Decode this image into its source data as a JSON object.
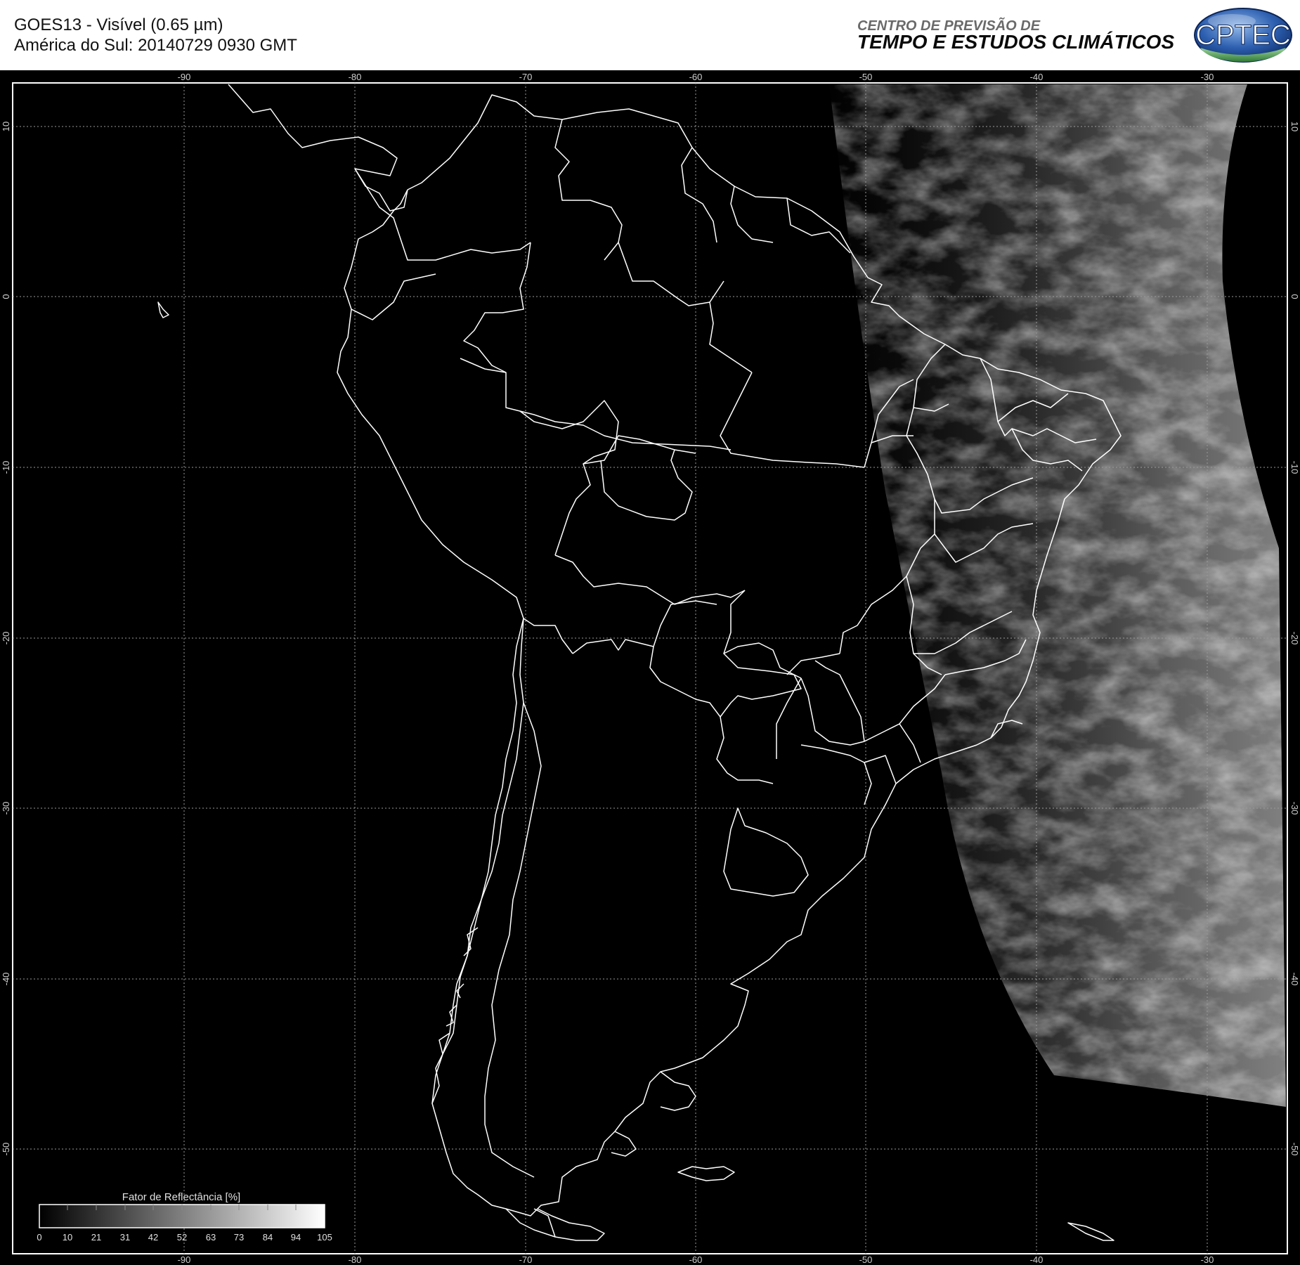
{
  "header": {
    "title_line1": "GOES13 - Visível (0.65 µm)",
    "title_line2": "América do Sul: 20140729 0930 GMT",
    "org_line1": "CENTRO DE PREVISÃO DE",
    "org_line2": "TEMPO E ESTUDOS CLIMÁTICOS",
    "logo_text": "CPTEC"
  },
  "map": {
    "background_color": "#000000",
    "coastline_color": "#ffffff",
    "grid_color": "#9a9a9a",
    "lon_labels": [
      "-90",
      "-80",
      "-70",
      "-60",
      "-50",
      "-40",
      "-30"
    ],
    "lat_labels": [
      "10",
      "0",
      "-10",
      "-20",
      "-30",
      "-40",
      "-50"
    ]
  },
  "colorbar": {
    "title": "Fator de Reflectância [%]",
    "ticks": [
      "0",
      "10",
      "21",
      "31",
      "42",
      "52",
      "63",
      "73",
      "84",
      "94",
      "105"
    ]
  }
}
